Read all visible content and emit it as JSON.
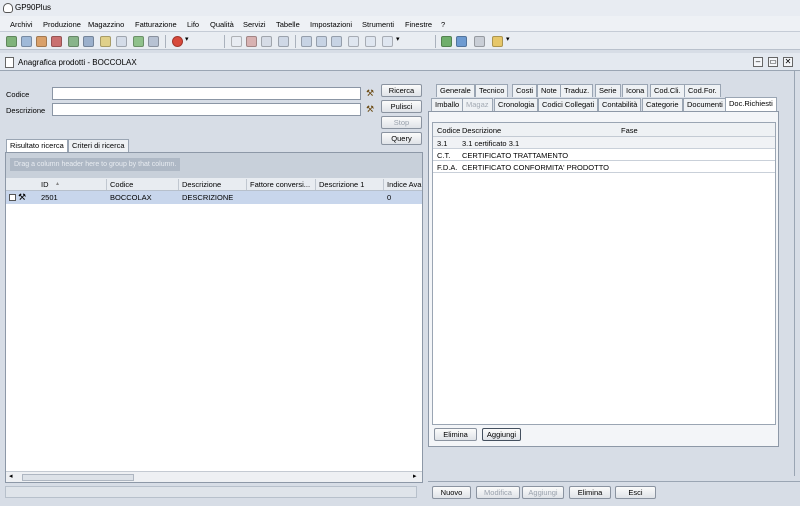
{
  "app": {
    "title": "GP90Plus"
  },
  "menu": [
    "Archivi",
    "Produzione",
    "Magazzino",
    "Fatturazione",
    "Lifo",
    "Qualità",
    "Servizi",
    "Tabelle",
    "Impostazioni",
    "Strumenti",
    "Finestre",
    "?"
  ],
  "document": {
    "title": "Anagrafica prodotti - BOCCOLAX"
  },
  "search": {
    "codice_label": "Codice",
    "descrizione_label": "Descrizione",
    "codice_value": "",
    "descrizione_value": "",
    "buttons": {
      "ricerca": "Ricerca",
      "pulisci": "Pulisci",
      "stop": "Stop",
      "query": "Query"
    }
  },
  "left_tabs": [
    "Risultato ricerca",
    "Criteri di ricerca"
  ],
  "grid": {
    "group_hint": "Drag a column header here to group by that column.",
    "columns": [
      "ID",
      "Codice",
      "Descrizione",
      "Fattore conversi...",
      "Descrizione 1",
      "Indice Ava"
    ],
    "rows": [
      {
        "id": "2501",
        "codice": "BOCCOLAX",
        "descrizione": "DESCRIZIONE",
        "fattore": "",
        "descrizione1": "",
        "indice": "0"
      }
    ]
  },
  "right_tabs_row1": [
    "Generale",
    "Tecnico",
    "Costi",
    "Note",
    "Traduz.",
    "Serie",
    "Icona",
    "Cod.Cli.",
    "Cod.For."
  ],
  "right_tabs_row2": [
    "Imballo",
    "Magaz",
    "Cronologia",
    "Codici Collegati",
    "Contabilità",
    "Categorie",
    "Documenti",
    "Doc.Richiesti"
  ],
  "doc_richiesti": {
    "columns": [
      "Codice",
      "Descrizione",
      "Fase"
    ],
    "rows": [
      {
        "codice": "3.1",
        "descrizione": "3.1 certificato 3.1",
        "fase": ""
      },
      {
        "codice": "C.T.",
        "descrizione": "CERTIFICATO TRATTAMENTO",
        "fase": ""
      },
      {
        "codice": "F.D.A.",
        "descrizione": "CERTIFICATO CONFORMITA' PRODOTTO",
        "fase": ""
      }
    ],
    "buttons": {
      "elimina": "Elimina",
      "aggiungi": "Aggiungi"
    }
  },
  "footer_buttons": {
    "nuovo": "Nuovo",
    "modifica": "Modifica",
    "aggiungi": "Aggiungi",
    "elimina": "Elimina",
    "esci": "Esci"
  },
  "window_controls": {
    "minimize": "–",
    "restore": "▭",
    "close": "✕"
  },
  "colors": {
    "background": "#d7dde6",
    "selected_row": "#c8d6ec",
    "panel": "#f3f5f8"
  }
}
